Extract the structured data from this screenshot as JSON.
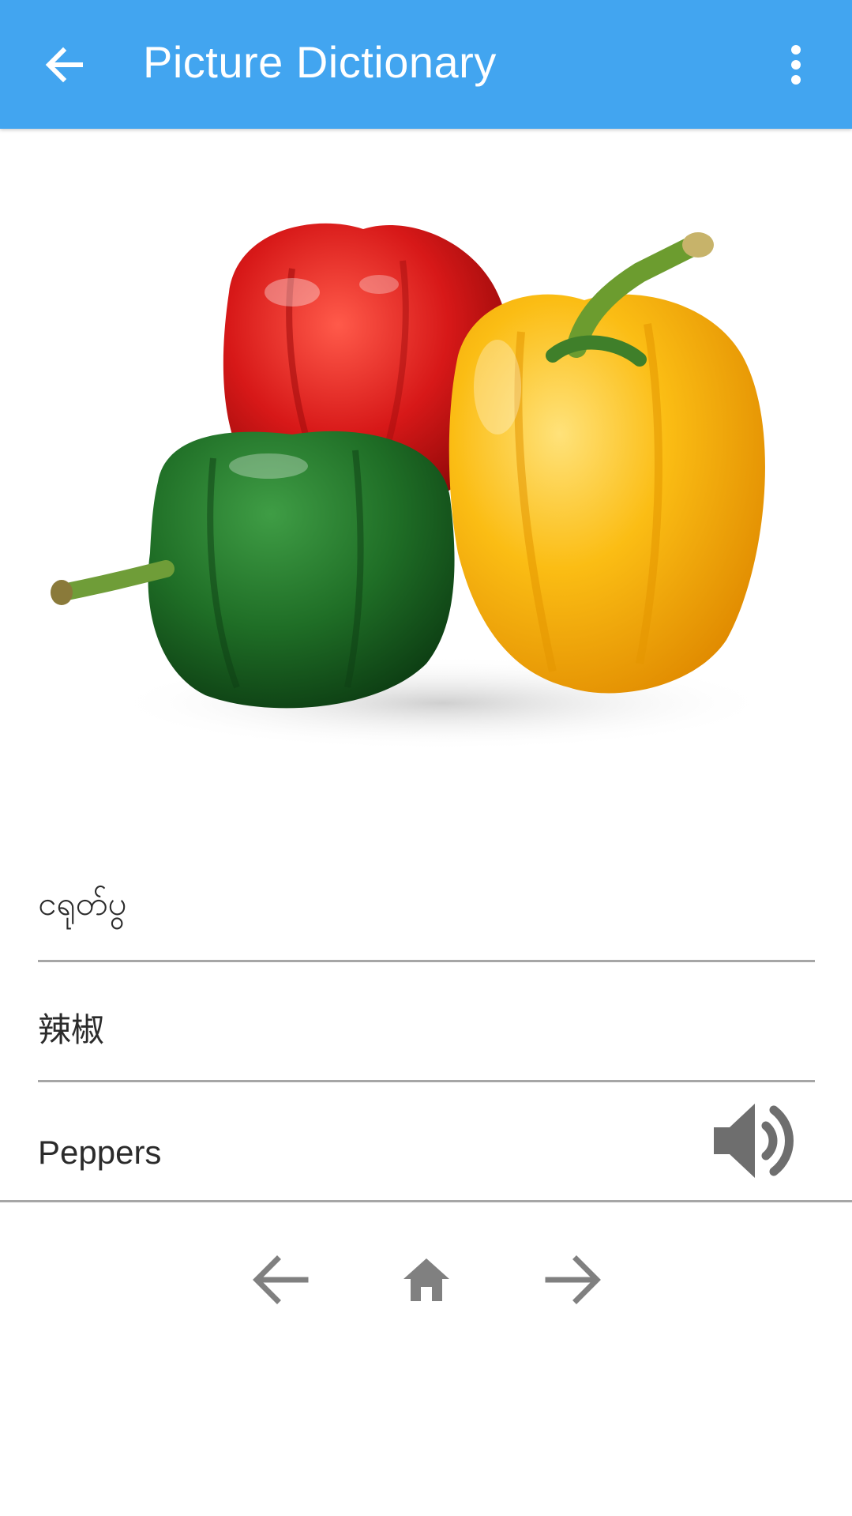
{
  "appbar": {
    "title": "Picture Dictionary",
    "back_icon": "arrow-left-icon",
    "more_icon": "more-vert-icon",
    "color": "#42a5f0"
  },
  "image": {
    "subject": "peppers",
    "colors": [
      "#d21616",
      "#f3b000",
      "#1e6e23"
    ]
  },
  "translations": [
    {
      "text": "ငရုတ်ပွ"
    },
    {
      "text": "辣椒"
    },
    {
      "text": "Peppers"
    }
  ],
  "speaker_icon": "volume-up-icon",
  "bottom_nav": {
    "prev_icon": "arrow-left-icon",
    "home_icon": "home-icon",
    "next_icon": "arrow-right-icon",
    "icon_color": "#808080"
  }
}
